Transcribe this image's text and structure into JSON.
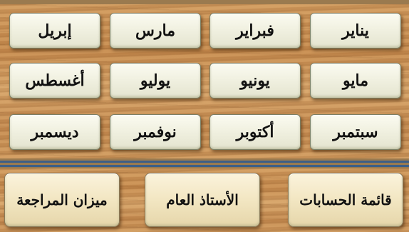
{
  "months": {
    "row1": [
      "يناير",
      "فبراير",
      "مارس",
      "إبريل"
    ],
    "row2": [
      "مايو",
      "يونيو",
      "يوليو",
      "أغسطس"
    ],
    "row3": [
      "سبتمبر",
      "أكتوبر",
      "نوفمبر",
      "ديسمبر"
    ]
  },
  "actions": {
    "accounts_list": "قائمة الحسابات",
    "general_ledger": "الأستاذ العام",
    "trial_balance": "ميزان المراجعة"
  },
  "colors": {
    "frame_line": "#3e5f86",
    "button_face": "#f1f1e1",
    "wood": "#c58a4e"
  }
}
